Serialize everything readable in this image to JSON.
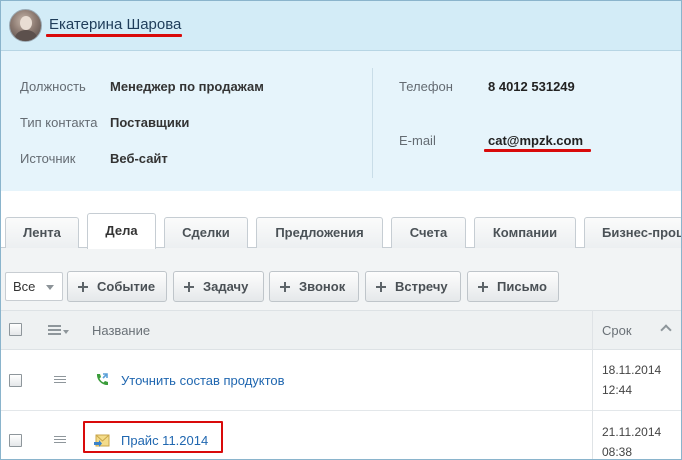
{
  "header": {
    "contact_name": "Екатерина Шарова"
  },
  "info": {
    "position_label": "Должность",
    "position_value": "Менеджер по продажам",
    "type_label": "Тип контакта",
    "type_value": "Поставщики",
    "source_label": "Источник",
    "source_value": "Веб-сайт",
    "phone_label": "Телефон",
    "phone_value": "8 4012 531249",
    "email_label": "E-mail",
    "email_value": "cat@mpzk.com"
  },
  "tabs": [
    {
      "label": "Лента"
    },
    {
      "label": "Дела"
    },
    {
      "label": "Сделки"
    },
    {
      "label": "Предложения"
    },
    {
      "label": "Счета"
    },
    {
      "label": "Компании"
    },
    {
      "label": "Бизнес-проц"
    }
  ],
  "toolbar": {
    "filter_value": "Все",
    "buttons": [
      {
        "label": "Событие"
      },
      {
        "label": "Задачу"
      },
      {
        "label": "Звонок"
      },
      {
        "label": "Встречу"
      },
      {
        "label": "Письмо"
      }
    ]
  },
  "grid": {
    "col_name": "Название",
    "col_deadline": "Срок",
    "rows": [
      {
        "title": "Уточнить состав продуктов",
        "date": "18.11.2014",
        "time": "12:44",
        "type_icon": "phone-call-icon"
      },
      {
        "title": "Прайс 11.2014",
        "date": "21.11.2014",
        "time": "08:38",
        "type_icon": "email-document-icon"
      }
    ]
  },
  "colors": {
    "header_bg": "#d3ecf7",
    "info_bg": "#e6f4fb",
    "link": "#2067b0",
    "highlight_red": "#d90a0a"
  }
}
